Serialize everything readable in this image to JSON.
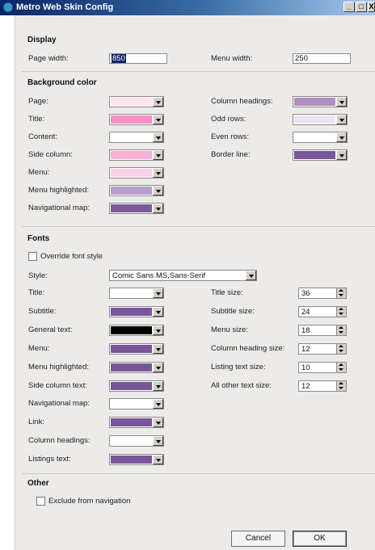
{
  "window": {
    "title": "Metro Web Skin Config",
    "icon": "app-globe-icon",
    "controls": [
      "_",
      "□",
      "X"
    ]
  },
  "display": {
    "heading": "Display",
    "page_width_label": "Page width:",
    "page_width_value": "850",
    "menu_width_label": "Menu width:",
    "menu_width_value": "250"
  },
  "background": {
    "heading": "Background color",
    "left": [
      {
        "label": "Page:",
        "color": "#fce6ef"
      },
      {
        "label": "Title:",
        "color": "#f98fc4"
      },
      {
        "label": "Content:",
        "color": "#ffffff"
      },
      {
        "label": "Side column:",
        "color": "#f9b0d5"
      },
      {
        "label": "Menu:",
        "color": "#fbd0e6"
      },
      {
        "label": "Menu highlighted:",
        "color": "#b79fcd"
      },
      {
        "label": "Navigational map:",
        "color": "#7b5a96"
      }
    ],
    "right": [
      {
        "label": "Column headings:",
        "color": "#b08fc2"
      },
      {
        "label": "Odd rows:",
        "color": "#ece4f0"
      },
      {
        "label": "Even rows:",
        "color": "#ffffff"
      },
      {
        "label": "Border line:",
        "color": "#77569a"
      }
    ]
  },
  "fonts": {
    "heading": "Fonts",
    "override_label": "Override font style",
    "override_checked": false,
    "style_label": "Style:",
    "style_value": "Comic Sans MS,Sans-Serif",
    "left": [
      {
        "label": "Title:",
        "color": "#ffffff"
      },
      {
        "label": "Subtitle:",
        "color": "#77569a"
      },
      {
        "label": "General text:",
        "color": "#000000"
      },
      {
        "label": "Menu:",
        "color": "#77569a"
      },
      {
        "label": "Menu highlighted:",
        "color": "#77569a"
      },
      {
        "label": "Side column text:",
        "color": "#77569a"
      },
      {
        "label": "Navigational map:",
        "color": "#ffffff"
      },
      {
        "label": "Link:",
        "color": "#77569a"
      },
      {
        "label": "Column headings:",
        "color": "#ffffff"
      },
      {
        "label": "Listings text:",
        "color": "#77569a"
      }
    ],
    "right": [
      {
        "label": "Title size:",
        "value": "36"
      },
      {
        "label": "Subtitle size:",
        "value": "24"
      },
      {
        "label": "Menu size:",
        "value": "18"
      },
      {
        "label": "Column heading size:",
        "value": "12"
      },
      {
        "label": "Listing text size:",
        "value": "10"
      },
      {
        "label": "All other text size:",
        "value": "12"
      }
    ]
  },
  "other": {
    "heading": "Other",
    "exclude_label": "Exclude from navigation",
    "exclude_checked": false
  },
  "buttons": {
    "cancel": "Cancel",
    "ok": "OK"
  }
}
